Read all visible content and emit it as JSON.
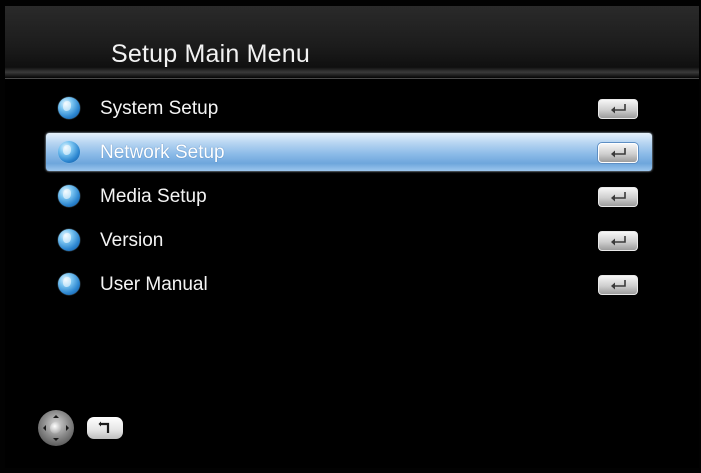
{
  "header": {
    "title": "Setup Main Menu"
  },
  "menu": {
    "selected_index": 1,
    "items": [
      {
        "label": "System Setup",
        "icon": "globe-icon",
        "action_icon": "enter-key-icon"
      },
      {
        "label": "Network Setup",
        "icon": "globe-icon",
        "action_icon": "enter-key-icon"
      },
      {
        "label": "Media Setup",
        "icon": "globe-icon",
        "action_icon": "enter-key-icon"
      },
      {
        "label": "Version",
        "icon": "globe-icon",
        "action_icon": "enter-key-icon"
      },
      {
        "label": "User Manual",
        "icon": "globe-icon",
        "action_icon": "enter-key-icon"
      }
    ]
  },
  "footer": {
    "nav_icon": "navigation-pad-icon",
    "return_icon": "return-key-icon"
  },
  "colors": {
    "background": "#000000",
    "selection_highlight": "#8cbbe8",
    "text": "#f4f4f4"
  }
}
